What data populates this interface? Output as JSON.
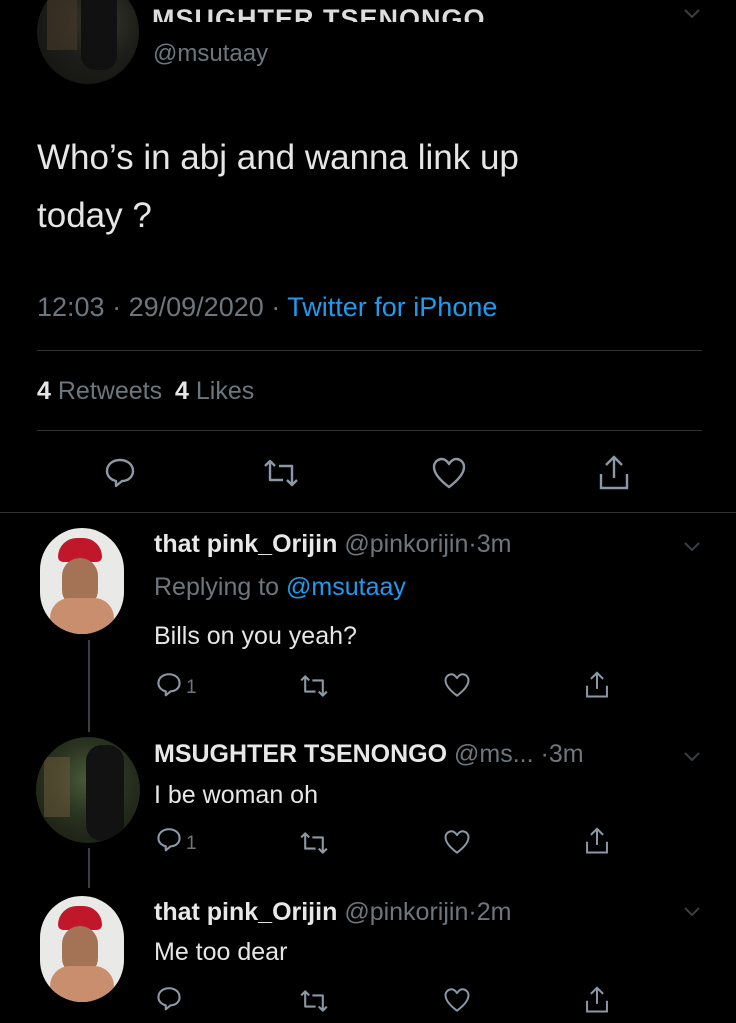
{
  "main_tweet": {
    "display_name": "MSUGHTER TSENONGO",
    "handle": "@msutaay",
    "text_line1": "Who’s in abj and wanna link up",
    "text_line2": "today ?",
    "time": "12:03",
    "date": "29/09/2020",
    "source": "Twitter for iPhone",
    "retweets_count": "4",
    "retweets_label": "Retweets",
    "likes_count": "4",
    "likes_label": "Likes"
  },
  "replies": [
    {
      "display_name": "that pink_Orijin",
      "handle": "@pinkorijin",
      "time": "3m",
      "replying_prefix": "Replying to",
      "replying_handle": "@msutaay",
      "text": "Bills on you yeah?",
      "reply_count": "1"
    },
    {
      "display_name": "MSUGHTER TSENONGO",
      "handle": "@ms...",
      "time": "3m",
      "text": "I be woman oh",
      "reply_count": "1"
    },
    {
      "display_name": "that pink_Orijin",
      "handle": "@pinkorijin",
      "time": "2m",
      "text": "Me too dear"
    }
  ],
  "separator": "·",
  "colors": {
    "background": "#000000",
    "accent": "#1d9bf0",
    "muted_text": "#6e767d",
    "divider": "#2f3336"
  },
  "icons": [
    "reply-icon",
    "retweet-icon",
    "like-icon",
    "share-icon",
    "chevron-down-icon"
  ]
}
